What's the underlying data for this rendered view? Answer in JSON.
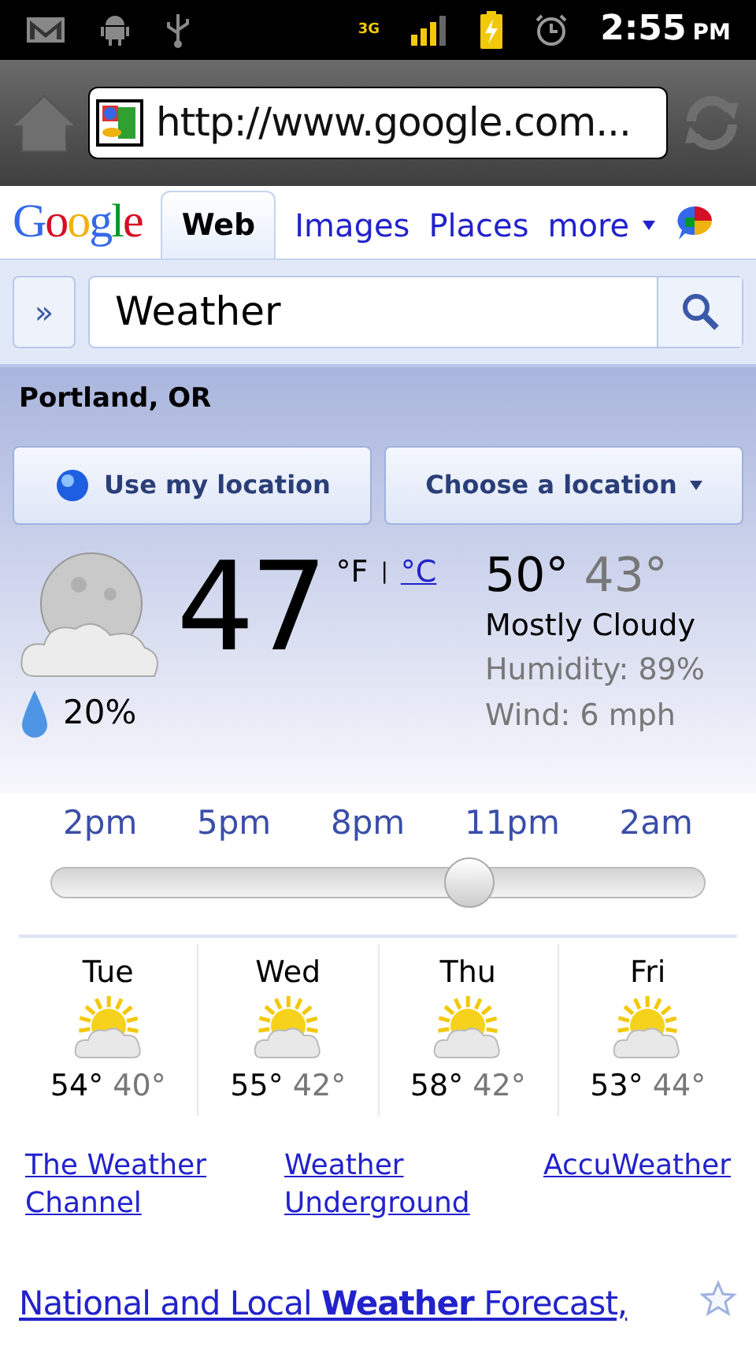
{
  "status_bar": {
    "time": "2:55",
    "ampm": "PM",
    "network": "3G"
  },
  "browser": {
    "url": "http://www.google.com..."
  },
  "nav": {
    "logo": "Google",
    "tabs": [
      {
        "label": "Web",
        "selected": true
      },
      {
        "label": "Images",
        "selected": false
      },
      {
        "label": "Places",
        "selected": false
      }
    ],
    "more": "more"
  },
  "search": {
    "expand": "»",
    "value": "Weather"
  },
  "weather": {
    "location": "Portland, OR",
    "buttons": [
      {
        "label": "Use my location",
        "kind": "locate"
      },
      {
        "label": "Choose a location",
        "kind": "dropdown"
      }
    ],
    "temperature": "47",
    "unit_f": "°F",
    "separator": "|",
    "unit_c": "°C",
    "precipitation": "20%",
    "high": "50°",
    "low": "43°",
    "condition": "Mostly Cloudy",
    "humidity": "Humidity: 89%",
    "wind": "Wind: 6 mph",
    "hours": [
      "2pm",
      "5pm",
      "8pm",
      "11pm",
      "2am"
    ],
    "slider": {
      "level": 0.65
    },
    "days": [
      {
        "day": "Tue",
        "high": "54°",
        "low": "40°"
      },
      {
        "day": "Wed",
        "high": "55°",
        "low": "42°"
      },
      {
        "day": "Thu",
        "high": "58°",
        "low": "42°"
      },
      {
        "day": "Fri",
        "high": "53°",
        "low": "44°"
      }
    ],
    "sources": [
      "The Weather Channel",
      "Weather Underground",
      "AccuWeather"
    ]
  },
  "result": {
    "title": "National and Local **Weather** Forecast,"
  }
}
